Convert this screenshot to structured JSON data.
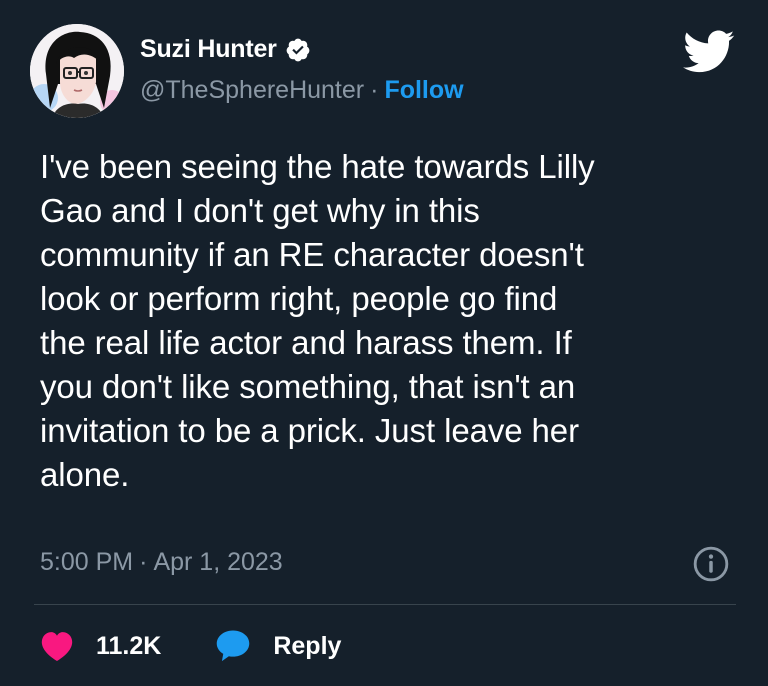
{
  "author": {
    "display_name": "Suzi Hunter",
    "handle": "@TheSphereHunter",
    "separator": "·",
    "follow_label": "Follow",
    "verified": true
  },
  "tweet": {
    "text": "I've been seeing the hate towards Lilly\nGao and I don't get why in this\ncommunity if an RE character doesn't\nlook or perform right, people go find\nthe real life actor and harass them. If\nyou don't like something, that isn't an\ninvitation to be a prick. Just leave her\nalone.",
    "time": "5:00 PM",
    "date_separator": "·",
    "date": "Apr 1, 2023"
  },
  "actions": {
    "like_count": "11.2K",
    "reply_label": "Reply"
  },
  "icons": {
    "brand": "twitter-bird-icon",
    "verified": "verified-badge-icon",
    "info": "info-icon",
    "like": "heart-icon",
    "reply": "speech-bubble-icon"
  },
  "colors": {
    "background": "#15202b",
    "text": "#ffffff",
    "secondary_text": "#8b98a5",
    "accent": "#1d9bf0",
    "like": "#f91880",
    "divider": "#38444d"
  }
}
